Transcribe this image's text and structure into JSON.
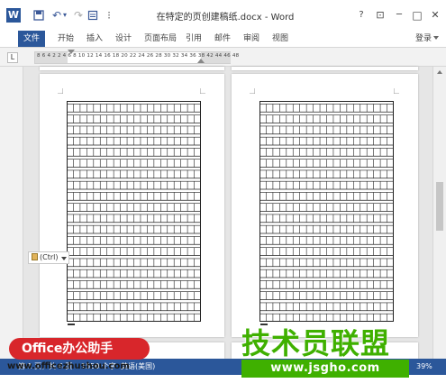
{
  "window": {
    "title": "在特定的页创建稿纸.docx - Word",
    "logo": "W",
    "help": "?",
    "ribbon_options": "⊡",
    "minimize": "─",
    "maximize": "□",
    "close": "✕"
  },
  "quick_access": {
    "save": "save-icon",
    "undo": "↶",
    "undo_dropdown": "▾",
    "redo": "↷",
    "print_preview": "print-preview-icon",
    "customize": "⁝"
  },
  "ribbon": {
    "tabs": [
      "文件",
      "开始",
      "插入",
      "设计",
      "页面布局",
      "引用",
      "邮件",
      "审阅",
      "视图"
    ],
    "active_tab": "文件",
    "sign_in": "登录"
  },
  "ruler": {
    "tab_selector": "L",
    "markings": "8 6 4 2   2  4  6  8 10 12 14 16 18 20 22 24 26 28 30 32 34 36 38    42 44 46 48"
  },
  "paste_options": {
    "label": "(Ctrl)"
  },
  "status_bar": {
    "page": "第 1 页，共 6 页",
    "words": "1550 个字",
    "language": "英语(美国)",
    "zoom": "39%"
  },
  "watermarks": {
    "office_badge": "Office办公助手",
    "office_url": "www.officezhushou.com",
    "brand": "技术员联盟",
    "brand_url": "www.jsgho.com"
  },
  "colors": {
    "word_blue": "#2b579a",
    "grid_line": "#222222",
    "badge_red": "#d8262b",
    "brand_green": "#3fb000"
  }
}
